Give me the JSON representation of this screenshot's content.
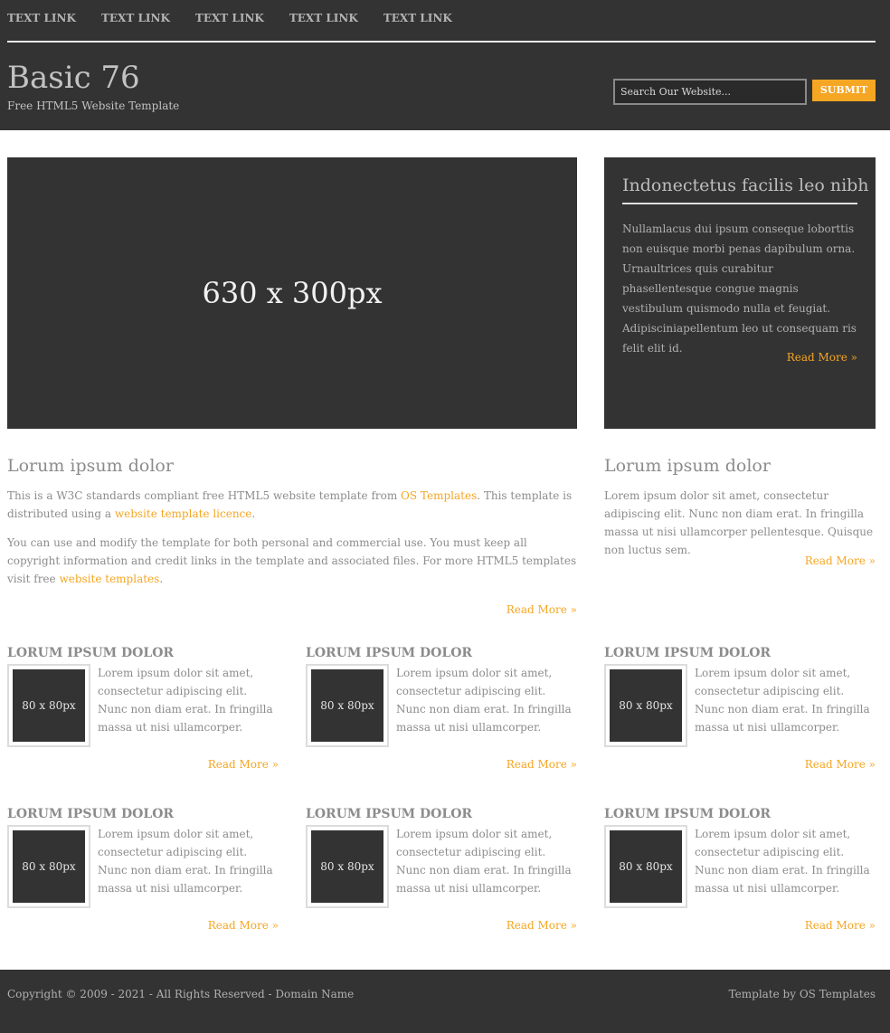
{
  "nav": {
    "items": [
      "TEXT LINK",
      "TEXT LINK",
      "TEXT LINK",
      "TEXT LINK",
      "TEXT LINK"
    ]
  },
  "header": {
    "title": "Basic 76",
    "subtitle": "Free HTML5 Website Template",
    "search_value": "Search Our Website...",
    "submit_label": "SUBMIT"
  },
  "feature": {
    "placeholder": "630 x 300px"
  },
  "sidebox": {
    "title": "Indonectetus facilis leo nibh",
    "text": "Nullamlacus dui ipsum conseque loborttis non euisque morbi penas dapibulum orna. Urnaultrices quis curabitur phasellentesque congue magnis vestibulum quismodo nulla et feugiat. Adipisciniapellentum leo ut consequam ris felit elit id.",
    "read_more": "Read More »"
  },
  "intro_left": {
    "title": "Lorum ipsum dolor",
    "p1_a": "This is a W3C standards compliant free HTML5 website template from ",
    "p1_link1": "OS Templates",
    "p1_b": ". This template is distributed using a ",
    "p1_link2": "website template licence",
    "p1_c": ".",
    "p2_a": "You can use and modify the template for both personal and commercial use. You must keep all copyright information and credit links in the template and associated files. For more HTML5 templates visit free ",
    "p2_link": "website templates",
    "p2_b": ".",
    "read_more": "Read More »"
  },
  "intro_right": {
    "title": "Lorum ipsum dolor",
    "text": "Lorem ipsum dolor sit amet, consectetur adipiscing elit. Nunc non diam erat. In fringilla massa ut nisi ullamcorper pellentesque. Quisque non luctus sem.",
    "read_more": "Read More »"
  },
  "cards": [
    {
      "title": "LORUM IPSUM DOLOR",
      "thumb": "80 x 80px",
      "text": "Lorem ipsum dolor sit amet, consectetur adipiscing elit. Nunc non diam erat. In fringilla massa ut nisi ullamcorper.",
      "read_more": "Read More »"
    },
    {
      "title": "LORUM IPSUM DOLOR",
      "thumb": "80 x 80px",
      "text": "Lorem ipsum dolor sit amet, consectetur adipiscing elit. Nunc non diam erat. In fringilla massa ut nisi ullamcorper.",
      "read_more": "Read More »"
    },
    {
      "title": "LORUM IPSUM DOLOR",
      "thumb": "80 x 80px",
      "text": "Lorem ipsum dolor sit amet, consectetur adipiscing elit. Nunc non diam erat. In fringilla massa ut nisi ullamcorper.",
      "read_more": "Read More »"
    },
    {
      "title": "LORUM IPSUM DOLOR",
      "thumb": "80 x 80px",
      "text": "Lorem ipsum dolor sit amet, consectetur adipiscing elit. Nunc non diam erat. In fringilla massa ut nisi ullamcorper.",
      "read_more": "Read More »"
    },
    {
      "title": "LORUM IPSUM DOLOR",
      "thumb": "80 x 80px",
      "text": "Lorem ipsum dolor sit amet, consectetur adipiscing elit. Nunc non diam erat. In fringilla massa ut nisi ullamcorper.",
      "read_more": "Read More »"
    },
    {
      "title": "LORUM IPSUM DOLOR",
      "thumb": "80 x 80px",
      "text": "Lorem ipsum dolor sit amet, consectetur adipiscing elit. Nunc non diam erat. In fringilla massa ut nisi ullamcorper.",
      "read_more": "Read More »"
    }
  ],
  "footer": {
    "copyright": "Copyright © 2009 - 2021 - All Rights Reserved - Domain Name",
    "credit": "Template by OS Templates"
  },
  "colors": {
    "dark": "#333333",
    "accent": "#f5a623",
    "text": "#8c8c8c"
  }
}
